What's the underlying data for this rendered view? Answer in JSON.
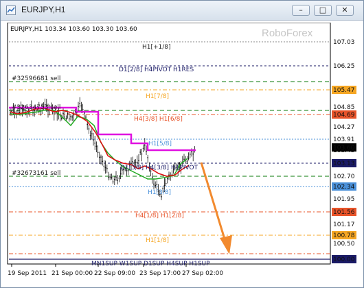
{
  "window": {
    "title": "EURJPY,H1",
    "buttons": [
      "–",
      "□",
      "✕"
    ]
  },
  "chart": {
    "info_line": "EURJPY,H1  103.34 103.60 103.30 103.60",
    "watermark": "RoboForex",
    "current_price": "103.60",
    "price_labels": [
      {
        "text": "107.03",
        "bg": "#ffffff",
        "fg": "#000000"
      },
      {
        "text": "106.25",
        "bg": "#ffffff",
        "fg": "#000000"
      },
      {
        "text": "105.47",
        "bg": "#f5a623",
        "fg": "#ffffff"
      },
      {
        "text": "104.85",
        "bg": "#ffffff",
        "fg": "#000000"
      },
      {
        "text": "104.69",
        "bg": "#e8542a",
        "fg": "#ffffff"
      },
      {
        "text": "104.27",
        "bg": "#ffffff",
        "fg": "#000000"
      },
      {
        "text": "103.91",
        "bg": "#ffffff",
        "fg": "#000000"
      },
      {
        "text": "103.45",
        "bg": "#ffffff",
        "fg": "#000000"
      },
      {
        "text": "103.13",
        "bg": "#1a1a66",
        "fg": "#ffffff"
      },
      {
        "text": "102.70",
        "bg": "#ffffff",
        "fg": "#000000"
      },
      {
        "text": "102.34",
        "bg": "#4a90d9",
        "fg": "#ffffff"
      },
      {
        "text": "101.95",
        "bg": "#ffffff",
        "fg": "#000000"
      },
      {
        "text": "101.56",
        "bg": "#e8542a",
        "fg": "#ffffff"
      },
      {
        "text": "101.17",
        "bg": "#ffffff",
        "fg": "#000000"
      },
      {
        "text": "100.78",
        "bg": "#f5a623",
        "fg": "#ffffff"
      },
      {
        "text": "100.50",
        "bg": "#ffffff",
        "fg": "#000000"
      },
      {
        "text": "100.00",
        "bg": "#1a1a66",
        "fg": "#ffffff"
      }
    ],
    "level_labels": [
      {
        "text": "H1[+1/8]",
        "color": "#222222"
      },
      {
        "text": "D1[2/8] H4PIVOT H1RES",
        "color": "#1a1a66"
      },
      {
        "text": "#32596681 sell",
        "color": "#222222"
      },
      {
        "text": "H1[7/8]",
        "color": "#f5a623"
      },
      {
        "text": "#32634753 sell",
        "color": "#222222"
      },
      {
        "text": "H4[3/8] H1[6/8]",
        "color": "#e8542a"
      },
      {
        "text": "H1[5/8]",
        "color": "#4a90d9"
      },
      {
        "text": "D1[3/8] H4[3/8] H1PIVOT",
        "color": "#1a1a66"
      },
      {
        "text": "#32673161 sell",
        "color": "#222222"
      },
      {
        "text": "H1[3/8]",
        "color": "#4a90d9"
      },
      {
        "text": "H4[1/8] H1[2/8]",
        "color": "#e8542a"
      },
      {
        "text": "H1[1/8]",
        "color": "#f5a623"
      },
      {
        "text": "MN1SUP W1SUP D1SUP H4SUP H1SUP",
        "color": "#1a1a66"
      }
    ],
    "time_labels": [
      "19 Sep 2011",
      "21 Sep 00:00",
      "22 Sep 09:00",
      "23 Sep 17:00",
      "27 Sep 02:00"
    ]
  }
}
